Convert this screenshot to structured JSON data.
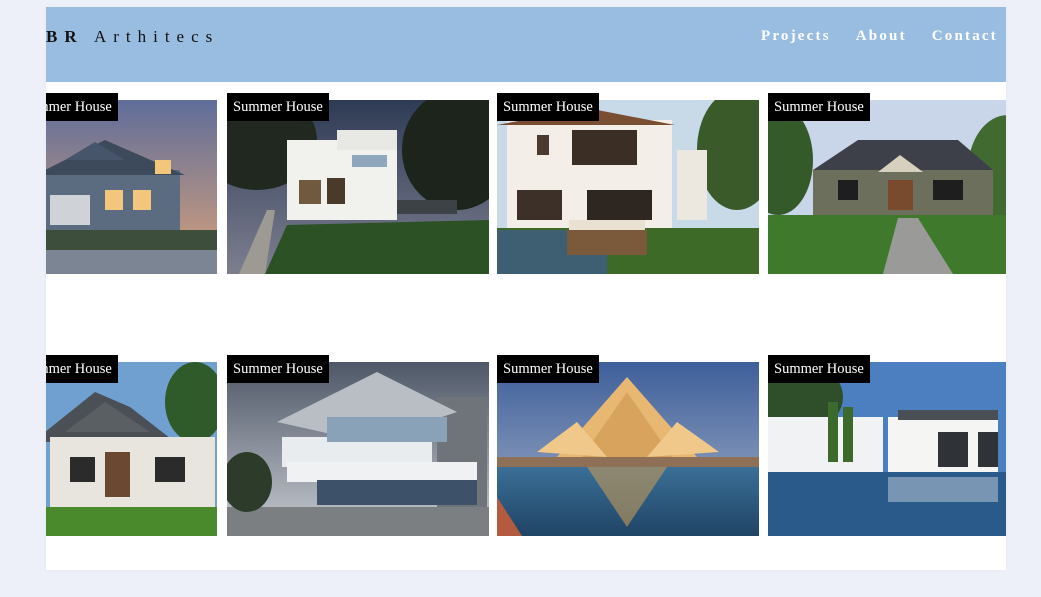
{
  "header": {
    "logo_bold": "BR",
    "logo_rest": "Arthitecs",
    "nav": [
      "Projects",
      "About",
      "Contact"
    ]
  },
  "gallery": {
    "tiles": [
      {
        "label": "Summer House"
      },
      {
        "label": "Summer House"
      },
      {
        "label": "Summer House"
      },
      {
        "label": "Summer House"
      },
      {
        "label": "Summer House"
      },
      {
        "label": "Summer House"
      },
      {
        "label": "Summer House"
      },
      {
        "label": "Summer House"
      }
    ]
  },
  "colors": {
    "header_bg": "#98bde1",
    "page_bg": "#edf0f8",
    "label_bg": "#000000"
  }
}
